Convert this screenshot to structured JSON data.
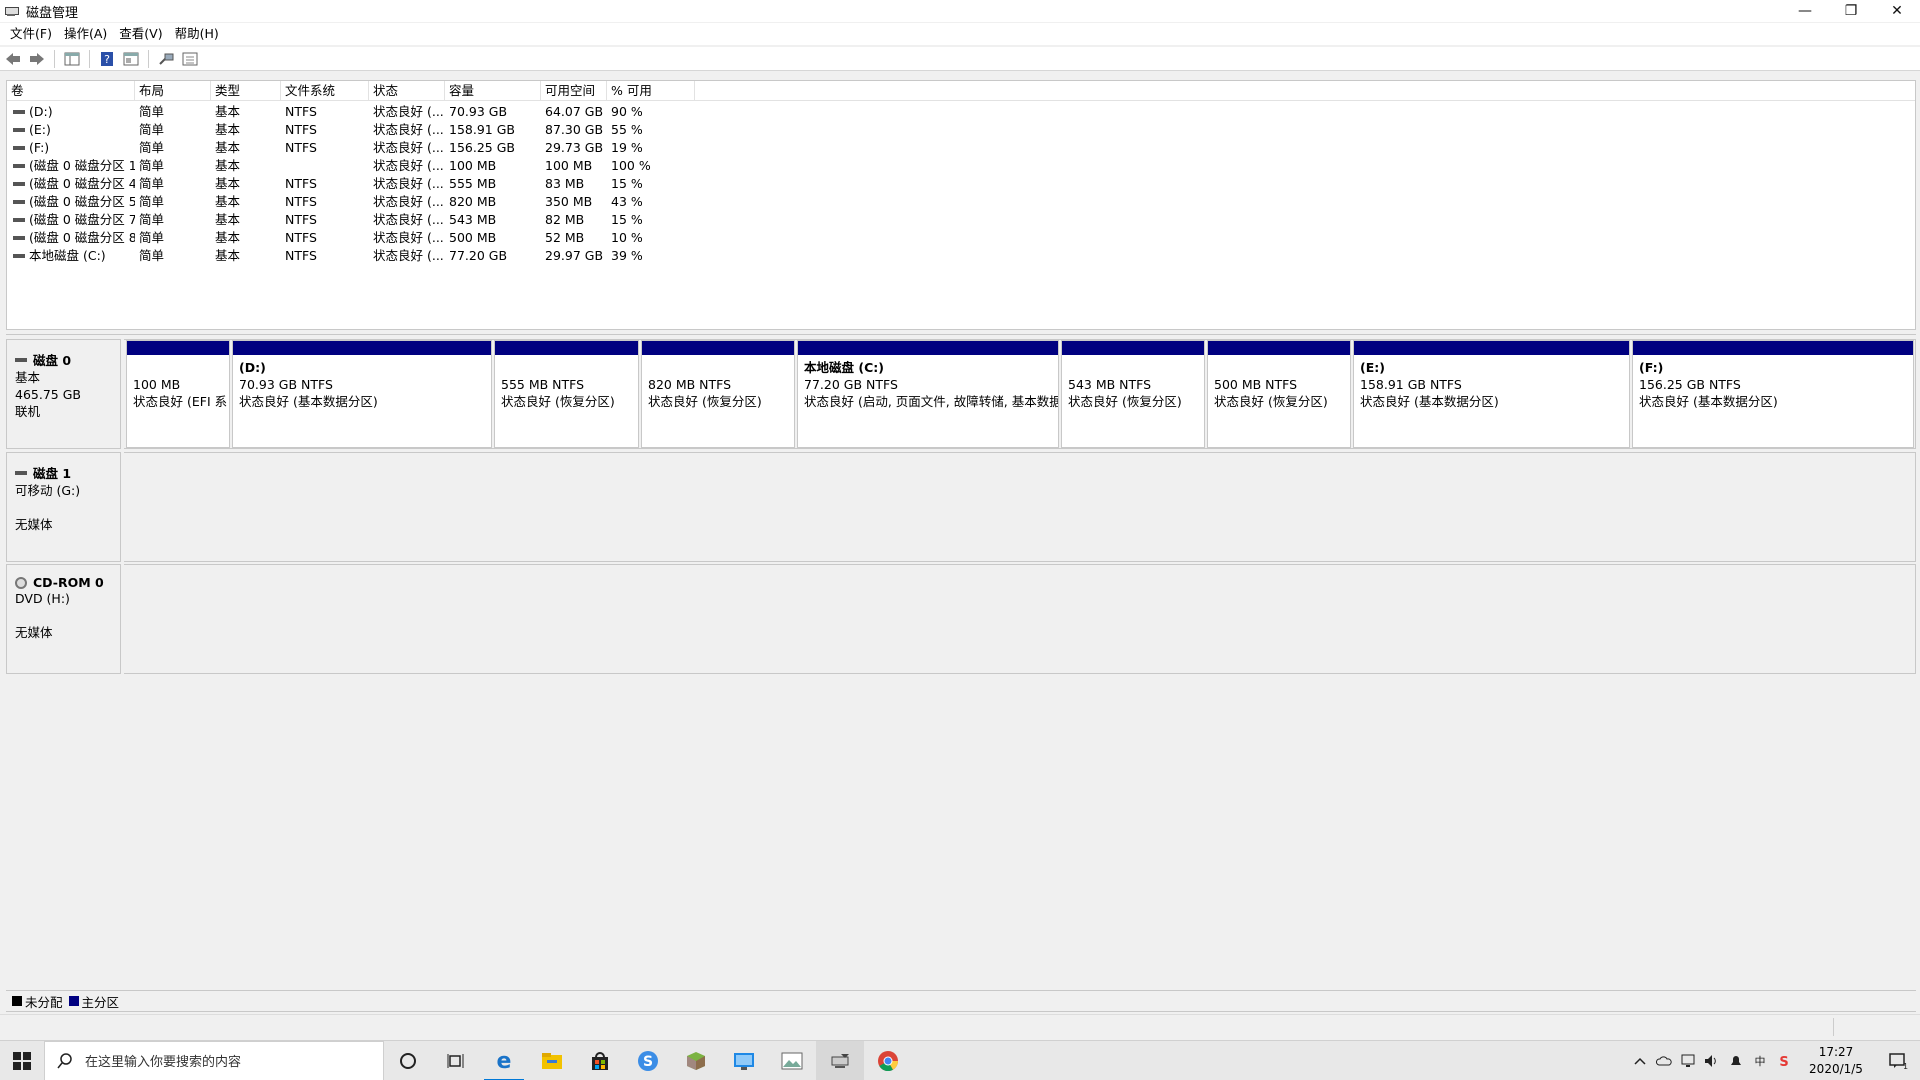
{
  "window": {
    "title": "磁盘管理",
    "controls": {
      "minimize": "—",
      "restore": "❐",
      "close": "✕"
    }
  },
  "menu": [
    "文件(F)",
    "操作(A)",
    "查看(V)",
    "帮助(H)"
  ],
  "toolbar": [
    "back-icon",
    "forward-icon",
    "console-tree-icon",
    "help-icon",
    "properties-icon",
    "connect-icon",
    "list-view-icon"
  ],
  "volume_table": {
    "headers": [
      "卷",
      "布局",
      "类型",
      "文件系统",
      "状态",
      "容量",
      "可用空间",
      "% 可用"
    ],
    "rows": [
      [
        "(D:)",
        "简单",
        "基本",
        "NTFS",
        "状态良好 (...",
        "70.93 GB",
        "64.07 GB",
        "90 %"
      ],
      [
        "(E:)",
        "简单",
        "基本",
        "NTFS",
        "状态良好 (...",
        "158.91 GB",
        "87.30 GB",
        "55 %"
      ],
      [
        "(F:)",
        "简单",
        "基本",
        "NTFS",
        "状态良好 (...",
        "156.25 GB",
        "29.73 GB",
        "19 %"
      ],
      [
        "(磁盘 0 磁盘分区 1)",
        "简单",
        "基本",
        "",
        "状态良好 (...",
        "100 MB",
        "100 MB",
        "100 %"
      ],
      [
        "(磁盘 0 磁盘分区 4)",
        "简单",
        "基本",
        "NTFS",
        "状态良好 (...",
        "555 MB",
        "83 MB",
        "15 %"
      ],
      [
        "(磁盘 0 磁盘分区 5)",
        "简单",
        "基本",
        "NTFS",
        "状态良好 (...",
        "820 MB",
        "350 MB",
        "43 %"
      ],
      [
        "(磁盘 0 磁盘分区 7)",
        "简单",
        "基本",
        "NTFS",
        "状态良好 (...",
        "543 MB",
        "82 MB",
        "15 %"
      ],
      [
        "(磁盘 0 磁盘分区 8)",
        "简单",
        "基本",
        "NTFS",
        "状态良好 (...",
        "500 MB",
        "52 MB",
        "10 %"
      ],
      [
        "本地磁盘 (C:)",
        "简单",
        "基本",
        "NTFS",
        "状态良好 (...",
        "77.20 GB",
        "29.97 GB",
        "39 %"
      ]
    ]
  },
  "disks": [
    {
      "name": "磁盘 0",
      "lines": [
        "基本",
        "465.75 GB",
        "联机"
      ],
      "partitions": [
        {
          "name": "",
          "size": "100 MB",
          "status": "状态良好 (EFI 系"
        },
        {
          "name": "(D:)",
          "size": "70.93 GB NTFS",
          "status": "状态良好 (基本数据分区)"
        },
        {
          "name": "",
          "size": "555 MB NTFS",
          "status": "状态良好 (恢复分区)"
        },
        {
          "name": "",
          "size": "820 MB NTFS",
          "status": "状态良好 (恢复分区)"
        },
        {
          "name": "本地磁盘 (C:)",
          "size": "77.20 GB NTFS",
          "status": "状态良好 (启动, 页面文件, 故障转储, 基本数据"
        },
        {
          "name": "",
          "size": "543 MB NTFS",
          "status": "状态良好 (恢复分区)"
        },
        {
          "name": "",
          "size": "500 MB NTFS",
          "status": "状态良好 (恢复分区)"
        },
        {
          "name": "(E:)",
          "size": "158.91 GB NTFS",
          "status": "状态良好 (基本数据分区)"
        },
        {
          "name": "(F:)",
          "size": "156.25 GB NTFS",
          "status": "状态良好 (基本数据分区)"
        }
      ]
    },
    {
      "name": "磁盘 1",
      "lines": [
        "可移动 (G:)",
        "",
        "无媒体"
      ]
    },
    {
      "name": "CD-ROM 0",
      "lines": [
        "DVD (H:)",
        "",
        "无媒体"
      ]
    }
  ],
  "legend": [
    {
      "label": "未分配",
      "color": "#000000"
    },
    {
      "label": "主分区",
      "color": "#000080"
    }
  ],
  "taskbar": {
    "search_placeholder": "在这里输入你要搜索的内容",
    "apps": [
      "cortana-icon",
      "task-view-icon",
      "edge-icon",
      "file-explorer-icon",
      "store-icon",
      "sogou-icon",
      "minecraft-icon",
      "remote-desktop-icon",
      "photos-icon",
      "disk-management-icon",
      "chrome-icon"
    ],
    "time": "17:27",
    "date": "2020/1/5",
    "notification_count": "1"
  },
  "colors": {
    "primary_partition": "#000080",
    "unallocated": "#000000"
  }
}
